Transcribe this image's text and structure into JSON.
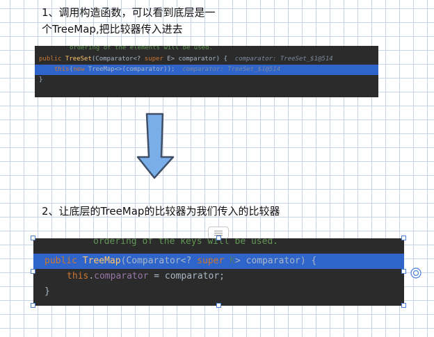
{
  "step1": {
    "line1": "1、调用构造函数，可以看到底层是一",
    "line2": "个TreeMap,把比较器传入进去"
  },
  "code1": {
    "comment": "ordering of the elements will be used.",
    "l2": {
      "kw_public": "public",
      "name": "TreeSet",
      "p1": "(Comparator<? ",
      "kw_super": "super",
      "p2": " E> comparator) {",
      "hint": "comparator: TreeSet_$1@514"
    },
    "l3": {
      "kw_this": "this",
      "p1": "(",
      "kw_new": "new",
      "p2": " TreeMap<>(comparator));",
      "hint": "comparator: TreeSet_$1@514"
    },
    "l4": "}"
  },
  "step2": {
    "text": "2、让底层的TreeMap的比较器为我们传入的比较器"
  },
  "code2": {
    "comment": "ordering of the keys will be used.",
    "l2": {
      "kw_public": "public",
      "name": "TreeMap",
      "p1": "(Comparator<? ",
      "kw_super": "super",
      "type_k": "K",
      "p2": "> comparator) {"
    },
    "l3": {
      "kw_this": "this",
      "dot": ".",
      "field": "comparator",
      "rest": " = comparator;"
    },
    "l4": "}"
  },
  "colors": {
    "code_bg": "#2b2b2b",
    "selection": "#2f65ca",
    "keyword": "#cc7832",
    "method": "#ffc66d",
    "comment": "#629755",
    "field": "#9876aa",
    "arrow_fill": "#79aee8",
    "grid": "#c9d3e6",
    "handle_border": "#4a7fd6"
  },
  "icons": {
    "arrow": "down-arrow-icon",
    "collapse": "collapse-tab-icon",
    "rotate": "rotate-handle-icon"
  }
}
